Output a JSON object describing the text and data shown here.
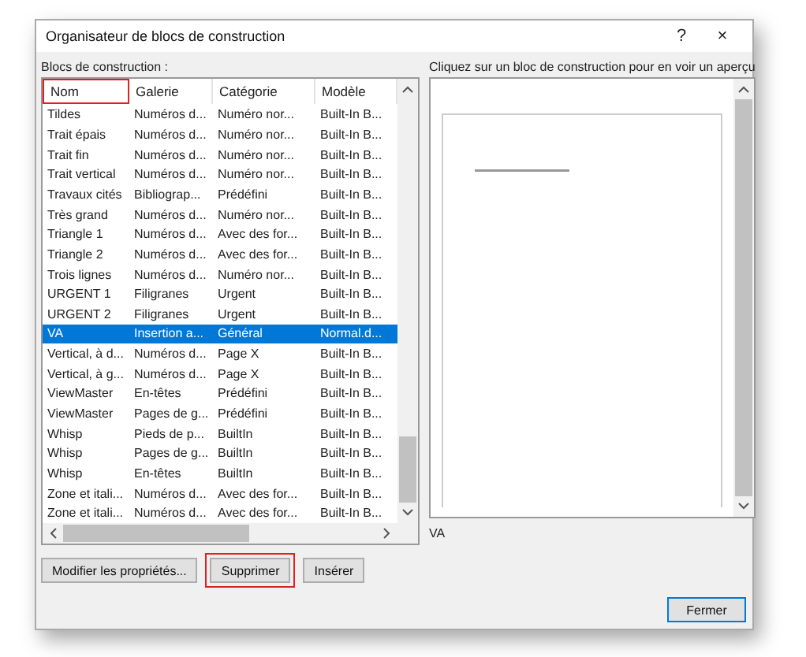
{
  "window": {
    "title": "Organisateur de blocs de construction",
    "help": "?",
    "close": "×"
  },
  "list_label": "Blocs de construction :",
  "table": {
    "columns": [
      {
        "label": "Nom",
        "highlighted": true
      },
      {
        "label": "Galerie",
        "highlighted": false
      },
      {
        "label": "Catégorie",
        "highlighted": false
      },
      {
        "label": "Modèle",
        "highlighted": false
      }
    ],
    "rows": [
      {
        "cells": [
          "Tildes",
          "Numéros d...",
          "Numéro nor...",
          "Built-In B..."
        ],
        "selected": false
      },
      {
        "cells": [
          "Trait épais",
          "Numéros d...",
          "Numéro nor...",
          "Built-In B..."
        ],
        "selected": false
      },
      {
        "cells": [
          "Trait fin",
          "Numéros d...",
          "Numéro nor...",
          "Built-In B..."
        ],
        "selected": false
      },
      {
        "cells": [
          "Trait vertical",
          "Numéros d...",
          "Numéro nor...",
          "Built-In B..."
        ],
        "selected": false
      },
      {
        "cells": [
          "Travaux cités",
          "Bibliograp...",
          "Prédéfini",
          "Built-In B..."
        ],
        "selected": false
      },
      {
        "cells": [
          "Très grand",
          "Numéros d...",
          "Numéro nor...",
          "Built-In B..."
        ],
        "selected": false
      },
      {
        "cells": [
          "Triangle 1",
          "Numéros d...",
          "Avec des for...",
          "Built-In B..."
        ],
        "selected": false
      },
      {
        "cells": [
          "Triangle 2",
          "Numéros d...",
          "Avec des for...",
          "Built-In B..."
        ],
        "selected": false
      },
      {
        "cells": [
          "Trois lignes",
          "Numéros d...",
          "Numéro nor...",
          "Built-In B..."
        ],
        "selected": false
      },
      {
        "cells": [
          "URGENT 1",
          "Filigranes",
          "Urgent",
          "Built-In B..."
        ],
        "selected": false
      },
      {
        "cells": [
          "URGENT 2",
          "Filigranes",
          "Urgent",
          "Built-In B..."
        ],
        "selected": false
      },
      {
        "cells": [
          "VA",
          "Insertion a...",
          "Général",
          "Normal.d..."
        ],
        "selected": true
      },
      {
        "cells": [
          "Vertical, à d...",
          "Numéros d...",
          "Page X",
          "Built-In B..."
        ],
        "selected": false
      },
      {
        "cells": [
          "Vertical, à g...",
          "Numéros d...",
          "Page X",
          "Built-In B..."
        ],
        "selected": false
      },
      {
        "cells": [
          "ViewMaster",
          "En-têtes",
          "Prédéfini",
          "Built-In B..."
        ],
        "selected": false
      },
      {
        "cells": [
          "ViewMaster",
          "Pages de g...",
          "Prédéfini",
          "Built-In B..."
        ],
        "selected": false
      },
      {
        "cells": [
          "Whisp",
          "Pieds de p...",
          "BuiltIn",
          "Built-In B..."
        ],
        "selected": false
      },
      {
        "cells": [
          "Whisp",
          "Pages de g...",
          "BuiltIn",
          "Built-In B..."
        ],
        "selected": false
      },
      {
        "cells": [
          "Whisp",
          "En-têtes",
          "BuiltIn",
          "Built-In B..."
        ],
        "selected": false
      },
      {
        "cells": [
          "Zone et itali...",
          "Numéros d...",
          "Avec des for...",
          "Built-In B..."
        ],
        "selected": false
      },
      {
        "cells": [
          "Zone et itali...",
          "Numéros d...",
          "Avec des for...",
          "Built-In B..."
        ],
        "selected": false
      }
    ]
  },
  "preview": {
    "label": "Cliquez sur un bloc de construction pour en voir un aperçu",
    "caption": "VA"
  },
  "buttons": [
    {
      "label": "Modifier les propriétés...",
      "highlighted": false
    },
    {
      "label": "Supprimer",
      "highlighted": true
    },
    {
      "label": "Insérer",
      "highlighted": false
    }
  ],
  "close_button": "Fermer"
}
